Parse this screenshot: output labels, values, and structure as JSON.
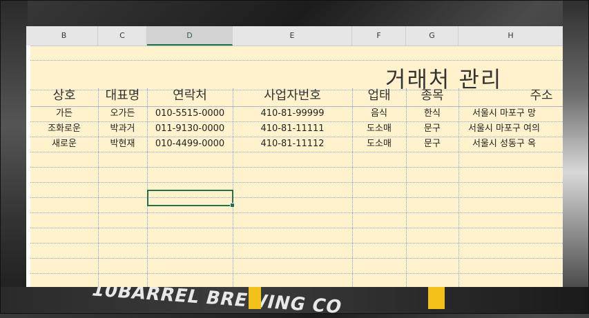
{
  "columns": [
    {
      "letter": "B"
    },
    {
      "letter": "C"
    },
    {
      "letter": "D",
      "selected": true
    },
    {
      "letter": "E"
    },
    {
      "letter": "F"
    },
    {
      "letter": "G"
    },
    {
      "letter": "H"
    }
  ],
  "sheet": {
    "title": "거래처 관리",
    "headers": [
      "상호",
      "대표명",
      "연락처",
      "사업자번호",
      "업태",
      "종목",
      "주소"
    ],
    "rows": [
      [
        "가든",
        "오가든",
        "010-5515-0000",
        "410-81-99999",
        "음식",
        "한식",
        "서울시 마포구 망"
      ],
      [
        "조화로운",
        "박과거",
        "011-9130-0000",
        "410-81-11111",
        "도소매",
        "문구",
        "서울시 마포구 여의"
      ],
      [
        "새로운",
        "박현재",
        "010-4499-0000",
        "410-81-11112",
        "도소매",
        "문구",
        "서울시 성동구 옥"
      ]
    ]
  },
  "background": {
    "brand_text": "10BARREL BREWING CO",
    "accent_color": "#f2c21b"
  },
  "colors": {
    "sheet_fill": "#fff2cc",
    "grid_line": "#8fa6d6",
    "selection": "#217346"
  }
}
